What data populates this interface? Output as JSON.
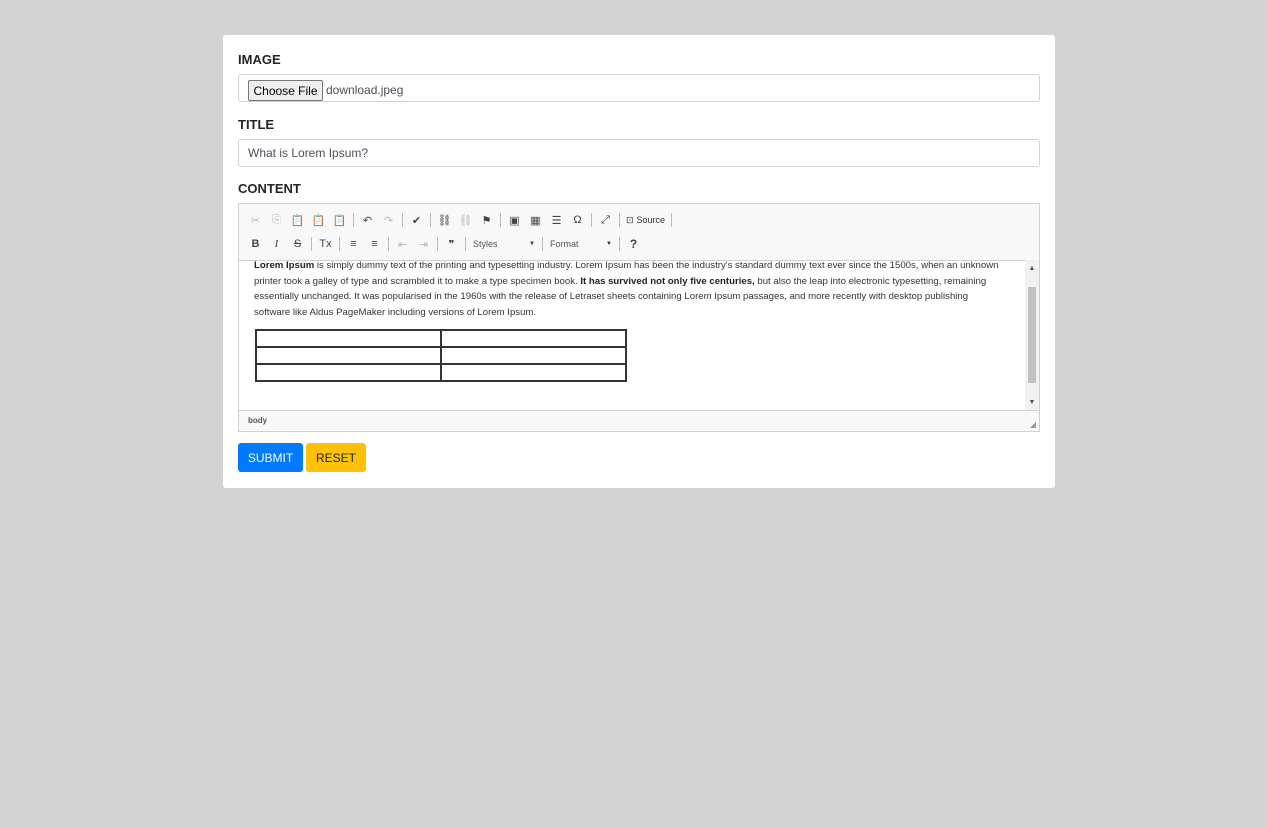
{
  "form": {
    "image_label": "IMAGE",
    "choose_file_label": "Choose File",
    "file_name": "download.jpeg",
    "title_label": "TITLE",
    "title_value": "What is Lorem Ipsum?",
    "content_label": "CONTENT",
    "submit_label": "SUBMIT",
    "reset_label": "RESET"
  },
  "toolbar": {
    "row1": [
      {
        "icon": "cut-icon",
        "glyph": "✂",
        "enabled": false
      },
      {
        "icon": "copy-icon",
        "glyph": "⎘",
        "enabled": false
      },
      {
        "icon": "paste-icon",
        "glyph": "📋",
        "enabled": true
      },
      {
        "icon": "paste-text-icon",
        "glyph": "📋",
        "enabled": true
      },
      {
        "icon": "paste-word-icon",
        "glyph": "📋",
        "enabled": true
      },
      {
        "icon": "undo-icon",
        "glyph": "↶",
        "enabled": true
      },
      {
        "icon": "redo-icon",
        "glyph": "↷",
        "enabled": false
      },
      {
        "icon": "spellcheck-icon",
        "glyph": "✔",
        "enabled": true
      },
      {
        "icon": "link-icon",
        "glyph": "⛓",
        "enabled": true
      },
      {
        "icon": "unlink-icon",
        "glyph": "⛓",
        "enabled": false
      },
      {
        "icon": "anchor-icon",
        "glyph": "⚑",
        "enabled": true
      },
      {
        "icon": "image-icon",
        "glyph": "▣",
        "enabled": true
      },
      {
        "icon": "table-icon",
        "glyph": "▦",
        "enabled": true
      },
      {
        "icon": "horizontal-line-icon",
        "glyph": "☰",
        "enabled": true
      },
      {
        "icon": "special-char-icon",
        "glyph": "Ω",
        "enabled": true
      },
      {
        "icon": "maximize-icon",
        "glyph": "⤢",
        "enabled": true
      }
    ],
    "source_label": "Source",
    "row2": [
      {
        "icon": "bold-icon",
        "glyph": "B",
        "enabled": true
      },
      {
        "icon": "italic-icon",
        "glyph": "I",
        "enabled": true
      },
      {
        "icon": "strike-icon",
        "glyph": "S",
        "enabled": true
      },
      {
        "icon": "remove-format-icon",
        "glyph": "Tx",
        "enabled": true
      },
      {
        "icon": "numbered-list-icon",
        "glyph": "≡",
        "enabled": true
      },
      {
        "icon": "bulleted-list-icon",
        "glyph": "≡",
        "enabled": true
      },
      {
        "icon": "outdent-icon",
        "glyph": "⇤",
        "enabled": false
      },
      {
        "icon": "indent-icon",
        "glyph": "⇥",
        "enabled": false
      },
      {
        "icon": "blockquote-icon",
        "glyph": "❞",
        "enabled": true
      },
      {
        "icon": "help-icon",
        "glyph": "?",
        "enabled": true
      }
    ],
    "styles_label": "Styles",
    "format_label": "Format"
  },
  "content": {
    "p_bold1": "Lorem Ipsum",
    "p_text1": " is simply dummy text of the printing and typesetting industry. Lorem Ipsum has been the industry's standard dummy text ever since the 1500s, when an unknown printer took a galley of type and scrambled it to make a type specimen book. ",
    "p_bold2": "It has survived not only five centuries,",
    "p_text2": " but also the leap into electronic typesetting, remaining essentially unchanged. It was popularised in the 1960s with the release of Letraset sheets containing Lorem Ipsum passages, and more recently with desktop publishing software like Aldus PageMaker including versions of Lorem Ipsum."
  },
  "statusbar": {
    "path": "body"
  }
}
